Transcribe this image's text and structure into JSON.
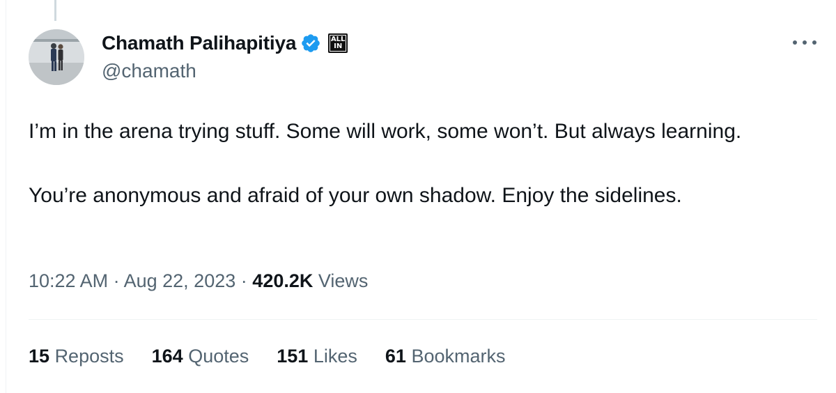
{
  "tweet": {
    "author": {
      "display_name": "Chamath Palihapitiya",
      "handle": "@chamath",
      "affiliate_badge_line1": "ALL",
      "affiliate_badge_line2": "IN"
    },
    "text": "I’m in the arena trying stuff. Some will work, some won’t. But always learning.\n\nYou’re anonymous and afraid of your own shadow. Enjoy the sidelines.",
    "time": "10:22 AM",
    "date": "Aug 22, 2023",
    "separator": "·",
    "views_count": "420.2K",
    "views_label": "Views",
    "stats": [
      {
        "count": "15",
        "label": "Reposts"
      },
      {
        "count": "164",
        "label": "Quotes"
      },
      {
        "count": "151",
        "label": "Likes"
      },
      {
        "count": "61",
        "label": "Bookmarks"
      }
    ]
  },
  "icons": {
    "verified": "verified-badge-icon",
    "more": "more-horizontal-icon"
  },
  "colors": {
    "verified_blue": "#1d9bf0",
    "text_primary": "#0f1419",
    "text_secondary": "#536471",
    "divider": "#eff3f4"
  }
}
